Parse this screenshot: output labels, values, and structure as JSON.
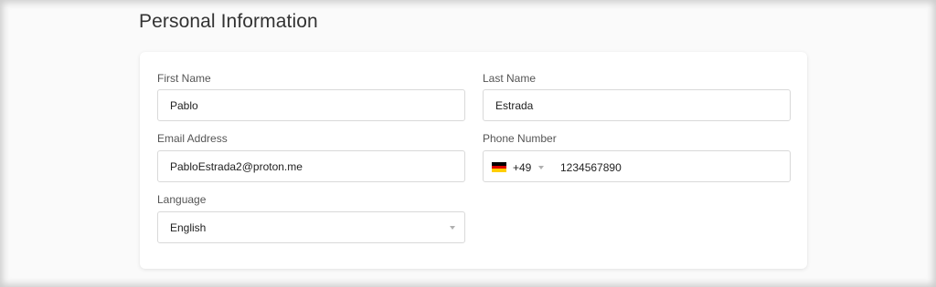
{
  "page": {
    "title": "Personal Information"
  },
  "form": {
    "first_name": {
      "label": "First Name",
      "value": "Pablo"
    },
    "last_name": {
      "label": "Last Name",
      "value": "Estrada"
    },
    "email": {
      "label": "Email Address",
      "value": "PabloEstrada2@proton.me"
    },
    "phone": {
      "label": "Phone Number",
      "country_flag_icon": "germany-flag-icon",
      "flag_colors": [
        "#000000",
        "#dd0000",
        "#ffce00"
      ],
      "dial_code": "+49",
      "number": "1234567890"
    },
    "language": {
      "label": "Language",
      "value": "English"
    }
  }
}
